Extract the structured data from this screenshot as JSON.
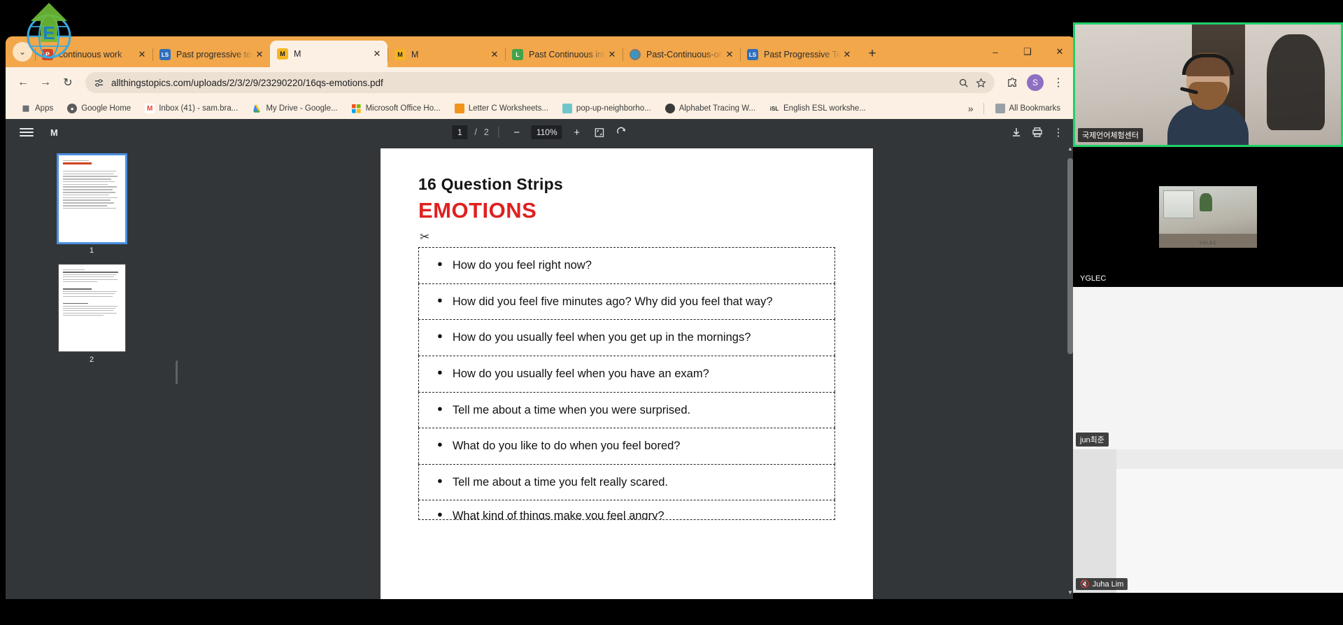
{
  "browser": {
    "tabs": [
      {
        "title": "continuous work",
        "favicon": "powerpoint-icon",
        "active": false
      },
      {
        "title": "Past progressive tens",
        "favicon": "liveworksheets-icon",
        "active": false
      },
      {
        "title": "M",
        "favicon": "pdf-m-icon",
        "active": true
      },
      {
        "title": "M",
        "favicon": "pdf-m-icon",
        "active": false
      },
      {
        "title": "Past Continuous inte",
        "favicon": "liveworksheets-icon",
        "active": false
      },
      {
        "title": "Past-Continuous-or-",
        "favicon": "globe-icon",
        "active": false
      },
      {
        "title": "Past Progressive Tens",
        "favicon": "liveworksheets-icon",
        "active": false
      }
    ],
    "new_tab_label": "+",
    "window_controls": {
      "minimize": "–",
      "maximize": "❑",
      "close": "✕"
    },
    "tab_caret": "⌄",
    "nav": {
      "back": "←",
      "forward": "→",
      "reload": "↻"
    },
    "omnibox": {
      "url": "allthingstopics.com/uploads/2/3/2/9/23290220/16qs-emotions.pdf",
      "site_settings_icon": "tune-icon",
      "zoom_icon": "zoom-icon",
      "bookmark_icon": "star-icon",
      "extensions_icon": "puzzle-icon",
      "profile_initial": "S",
      "menu_icon": "kebab-menu-icon"
    },
    "bookmarks": [
      {
        "label": "Apps",
        "icon": "apps-grid-icon"
      },
      {
        "label": "Google Home",
        "icon": "globe-icon"
      },
      {
        "label": "Inbox (41) - sam.bra...",
        "icon": "gmail-icon"
      },
      {
        "label": "My Drive - Google...",
        "icon": "drive-icon"
      },
      {
        "label": "Microsoft Office Ho...",
        "icon": "microsoft-icon"
      },
      {
        "label": "Letter C Worksheets...",
        "icon": "orange-doc-icon"
      },
      {
        "label": "pop-up-neighborho...",
        "icon": "teal-leaf-icon"
      },
      {
        "label": "Alphabet Tracing W...",
        "icon": "globe-icon"
      },
      {
        "label": "English ESL workshe...",
        "icon": "isl-icon"
      }
    ],
    "bookmarks_overflow": "»",
    "all_bookmarks_label": "All Bookmarks"
  },
  "pdf": {
    "menu_icon": "hamburger-menu-icon",
    "filename": "M",
    "current_page": "1",
    "page_separator": "/",
    "total_pages": "2",
    "zoom_out_icon": "minus-icon",
    "zoom_level": "110%",
    "zoom_in_icon": "plus-icon",
    "fit_icon": "fit-page-icon",
    "rotate_icon": "rotate-icon",
    "download_icon": "download-icon",
    "print_icon": "print-icon",
    "more_icon": "kebab-menu-icon",
    "thumbnails": [
      {
        "number": "1",
        "selected": true
      },
      {
        "number": "2",
        "selected": false
      }
    ],
    "document": {
      "title": "16 Question Strips",
      "subtitle": "EMOTIONS",
      "cut_icon": "scissors-icon",
      "strips": [
        "How do you feel right now?",
        "How did you feel five minutes ago?  Why did you feel that way?",
        "How do you usually feel when you get up in the mornings?",
        "How do you usually feel when you have an exam?",
        "Tell me about a time when you were surprised.",
        "What do you like to do when you feel bored?",
        "Tell me about a time you felt really scared.",
        "What kind of things make you feel angry?"
      ]
    }
  },
  "video_panel": {
    "tiles": [
      {
        "name": "국제언어체험센터",
        "muted": false,
        "active_speaker": true
      },
      {
        "name": "YGLEC",
        "muted": false,
        "active_speaker": false
      },
      {
        "name": "jun최준",
        "muted": false,
        "active_speaker": false
      },
      {
        "name": "Juha Lim",
        "muted": true,
        "active_speaker": false
      }
    ],
    "mic_muted_icon": "mic-muted-icon",
    "active_border_color": "#20d06a"
  },
  "colors": {
    "browser_frame": "#f2a74b",
    "toolbar_bg": "#fbf0e3",
    "pdf_chrome": "#323639",
    "accent_red": "#e02020",
    "active_speaker": "#20d06a"
  }
}
